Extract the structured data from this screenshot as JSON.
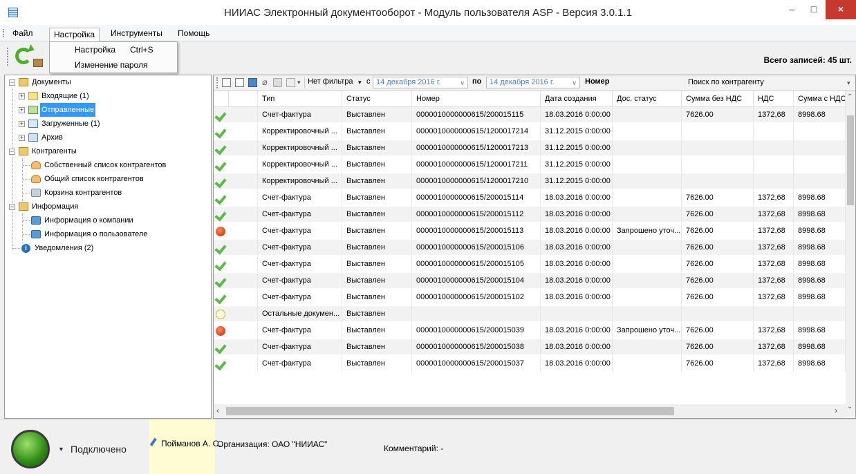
{
  "window": {
    "title": "НИИАС Электронный документооборот - Модуль пользователя ASP - Версия 3.0.1.1",
    "minimize": "–",
    "maximize": "□",
    "close": "×"
  },
  "menu": {
    "items": [
      "Файл",
      "Настройка",
      "Инструменты",
      "Помощь"
    ],
    "dropdown": [
      {
        "label": "Настройка",
        "shortcut": "Ctrl+S"
      },
      {
        "label": "Изменение пароля",
        "shortcut": ""
      }
    ]
  },
  "toolbar": {
    "total_records": "Всего записей: 45 шт."
  },
  "tree": {
    "documents": "Документы",
    "incoming": "Входящие (1)",
    "sent": "Отправленные",
    "loaded": "Загруженные (1)",
    "archive": "Архив",
    "counterparties": "Контрагенты",
    "own_list": "Собственный список контрагентов",
    "common_list": "Общий список контрагентов",
    "basket": "Корзина контрагентов",
    "info": "Информация",
    "company_info": "Информация о компании",
    "user_info": "Информация о пользователе",
    "notifications": "Уведомления (2)"
  },
  "filterbar": {
    "filter": "Нет фильтра",
    "from_label": "с",
    "date_from": "14 декабря  2016 г.",
    "to_label": "по",
    "date_to": "14 декабря  2016 г.",
    "number_label": "Номер",
    "search_counterparty": "Поиск по контрагенту"
  },
  "grid": {
    "columns": [
      "Тип",
      "Статус",
      "Номер",
      "Дата создания",
      "Дос. статус",
      "Сумма без НДС",
      "НДС",
      "Сумма с НДС"
    ],
    "rows": [
      {
        "icon": "check-icon",
        "type": "Счет-фактура",
        "status": "Выставлен",
        "number": "0000010000000615/200015115",
        "date": "18.03.2016 0:00:00",
        "doc_status": "",
        "sum": "7626.00",
        "vat": "1372,68",
        "total": "8998.68"
      },
      {
        "icon": "check-icon",
        "type": "Корректировочный ...",
        "status": "Выставлен",
        "number": "0000010000000615/1200017214",
        "date": "31.12.2015 0:00:00",
        "doc_status": "",
        "sum": "",
        "vat": "",
        "total": ""
      },
      {
        "icon": "check-icon",
        "type": "Корректировочный ...",
        "status": "Выставлен",
        "number": "0000010000000615/1200017213",
        "date": "31.12.2015 0:00:00",
        "doc_status": "",
        "sum": "",
        "vat": "",
        "total": ""
      },
      {
        "icon": "check-icon",
        "type": "Корректировочный ...",
        "status": "Выставлен",
        "number": "0000010000000615/1200017211",
        "date": "31.12.2015 0:00:00",
        "doc_status": "",
        "sum": "",
        "vat": "",
        "total": ""
      },
      {
        "icon": "check-icon",
        "type": "Корректировочный ...",
        "status": "Выставлен",
        "number": "0000010000000615/1200017210",
        "date": "31.12.2015 0:00:00",
        "doc_status": "",
        "sum": "",
        "vat": "",
        "total": ""
      },
      {
        "icon": "check-icon",
        "type": "Счет-фактура",
        "status": "Выставлен",
        "number": "0000010000000615/200015114",
        "date": "18.03.2016 0:00:00",
        "doc_status": "",
        "sum": "7626.00",
        "vat": "1372,68",
        "total": "8998.68"
      },
      {
        "icon": "check-icon",
        "type": "Счет-фактура",
        "status": "Выставлен",
        "number": "0000010000000615/200015112",
        "date": "18.03.2016 0:00:00",
        "doc_status": "",
        "sum": "7626.00",
        "vat": "1372,68",
        "total": "8998.68"
      },
      {
        "icon": "red-dot-icon",
        "type": "Счет-фактура",
        "status": "Выставлен",
        "number": "0000010000000615/200015113",
        "date": "18.03.2016 0:00:00",
        "doc_status": "Запрошено уточ...",
        "sum": "7626.00",
        "vat": "1372,68",
        "total": "8998.68"
      },
      {
        "icon": "check-icon",
        "type": "Счет-фактура",
        "status": "Выставлен",
        "number": "0000010000000615/200015106",
        "date": "18.03.2016 0:00:00",
        "doc_status": "",
        "sum": "7626.00",
        "vat": "1372,68",
        "total": "8998.68"
      },
      {
        "icon": "check-icon",
        "type": "Счет-фактура",
        "status": "Выставлен",
        "number": "0000010000000615/200015105",
        "date": "18.03.2016 0:00:00",
        "doc_status": "",
        "sum": "7626.00",
        "vat": "1372,68",
        "total": "8998.68"
      },
      {
        "icon": "check-icon",
        "type": "Счет-фактура",
        "status": "Выставлен",
        "number": "0000010000000615/200015104",
        "date": "18.03.2016 0:00:00",
        "doc_status": "",
        "sum": "7626.00",
        "vat": "1372,68",
        "total": "8998.68"
      },
      {
        "icon": "check-icon",
        "type": "Счет-фактура",
        "status": "Выставлен",
        "number": "0000010000000615/200015102",
        "date": "18.03.2016 0:00:00",
        "doc_status": "",
        "sum": "7626.00",
        "vat": "1372,68",
        "total": "8998.68"
      },
      {
        "icon": "yellow-dot-icon",
        "type": "Остальные докумен...",
        "status": "Выставлен",
        "number": "",
        "date": "",
        "doc_status": "",
        "sum": "",
        "vat": "",
        "total": ""
      },
      {
        "icon": "red-dot-icon",
        "type": "Счет-фактура",
        "status": "Выставлен",
        "number": "0000010000000615/200015039",
        "date": "18.03.2016 0:00:00",
        "doc_status": "Запрошено уточ...",
        "sum": "7626.00",
        "vat": "1372,68",
        "total": "8998.68"
      },
      {
        "icon": "check-icon",
        "type": "Счет-фактура",
        "status": "Выставлен",
        "number": "0000010000000615/200015038",
        "date": "18.03.2016 0:00:00",
        "doc_status": "",
        "sum": "7626.00",
        "vat": "1372,68",
        "total": "8998.68"
      },
      {
        "icon": "check-icon",
        "type": "Счет-фактура",
        "status": "Выставлен",
        "number": "0000010000000615/200015037",
        "date": "18.03.2016 0:00:00",
        "doc_status": "",
        "sum": "7626.00",
        "vat": "1372,68",
        "total": "8998.68"
      }
    ]
  },
  "statusbar": {
    "connected": "Подключено",
    "user": "Пойманов А. С.",
    "organization": "Организация:  ОАО \"НИИАС\"",
    "comment": "Комментарий:  -"
  }
}
